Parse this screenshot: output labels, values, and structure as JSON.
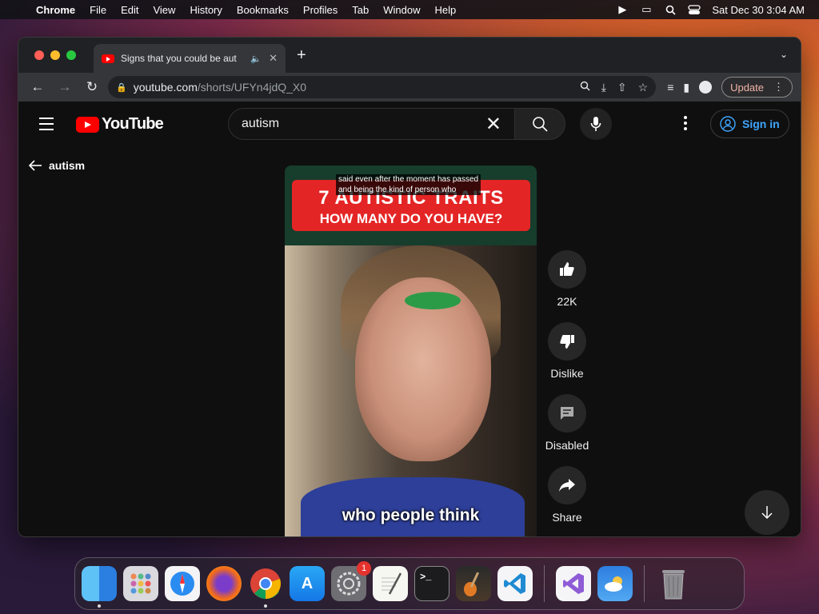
{
  "menubar": {
    "app_name": "Chrome",
    "items": [
      "File",
      "Edit",
      "View",
      "History",
      "Bookmarks",
      "Profiles",
      "Tab",
      "Window",
      "Help"
    ],
    "datetime": "Sat Dec 30  3:04 AM"
  },
  "browser": {
    "tab_title": "Signs that you could be aut",
    "url_host": "youtube.com",
    "url_path": "/shorts/UFYn4jdQ_X0",
    "update_label": "Update"
  },
  "youtube": {
    "logo_text": "YouTube",
    "search_value": "autism",
    "signin_label": "Sign in",
    "back_label": "autism",
    "short": {
      "caption_top_line1": "said even after the moment has passed",
      "caption_top_line2": "and being the kind of person who",
      "banner_line1": "7 AUTISTIC TRAITS",
      "banner_line2": "HOW MANY DO YOU HAVE?",
      "caption_bottom": "who people think"
    },
    "actions": {
      "like_count": "22K",
      "dislike_label": "Dislike",
      "comments_label": "Disabled",
      "share_label": "Share"
    }
  },
  "dock": {
    "apps": [
      "Finder",
      "Launchpad",
      "Safari",
      "Firefox",
      "Chrome",
      "App Store",
      "System Settings",
      "TextEdit",
      "Terminal",
      "GarageBand",
      "Visual Studio Code",
      "Visual Studio",
      "Weather",
      "Trash"
    ],
    "settings_badge": "1"
  },
  "colors": {
    "youtube_red": "#ff0000",
    "signin_blue": "#3ea6ff",
    "yt_background": "#0f0f0f"
  }
}
